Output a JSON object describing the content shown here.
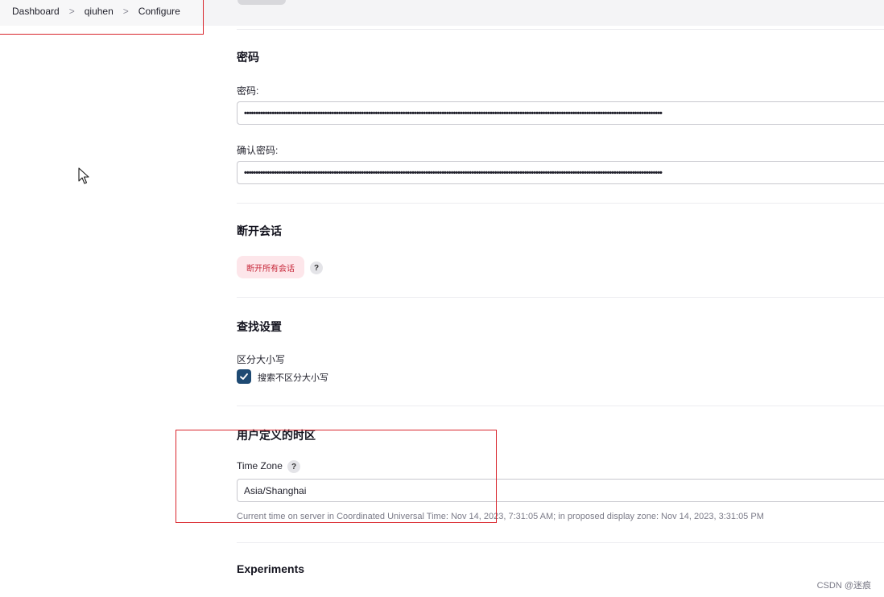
{
  "breadcrumb": {
    "items": [
      "Dashboard",
      "qiuhen",
      "Configure"
    ],
    "separator": ">"
  },
  "password_section": {
    "title": "密码",
    "password_label": "密码:",
    "password_value": "••••••••••••••••••••••••••••••••••••••••••••••••••••••••••••••••••••••••••••••••••••••••••••••••••••••••••••••••••••••••••••••••••••••••••••••••••••••••••••••••••••••••••••••••••••••",
    "confirm_label": "确认密码:",
    "confirm_value": "••••••••••••••••••••••••••••••••••••••••••••••••••••••••••••••••••••••••••••••••••••••••••••••••••••••••••••••••••••••••••••••••••••••••••••••••••••••••••••••••••••••••••••••••••••••"
  },
  "sessions_section": {
    "title": "断开会话",
    "button_label": "断开所有会话",
    "help": "?"
  },
  "search_section": {
    "title": "查找设置",
    "label": "区分大小写",
    "checkbox_label": "搜索不区分大小写",
    "checkbox_checked": true
  },
  "timezone_section": {
    "title": "用户定义的时区",
    "label": "Time Zone",
    "help": "?",
    "value": "Asia/Shanghai",
    "hint": "Current time on server in Coordinated Universal Time: Nov 14, 2023, 7:31:05 AM; in proposed display zone: Nov 14, 2023, 3:31:05 PM"
  },
  "experiments_section": {
    "title": "Experiments"
  },
  "watermark": "CSDN @迷痕",
  "colors": {
    "accent": "#1e4a73",
    "danger_bg": "#fde6ea",
    "danger_text": "#c7283a",
    "highlight": "#d9252c"
  }
}
